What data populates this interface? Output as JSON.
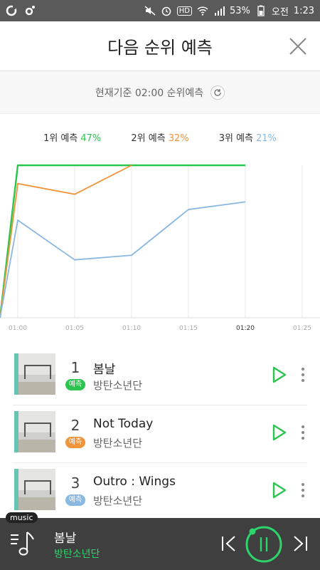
{
  "status": {
    "battery": "53%",
    "ampm": "오전",
    "time": "1:23",
    "hd": "HD"
  },
  "header": {
    "title": "다음 순위 예측"
  },
  "subheader": {
    "text": "현재기준 02:00 순위예측"
  },
  "legend": [
    {
      "label": "1위 예측",
      "pct": "47%",
      "color": "#2bc44e"
    },
    {
      "label": "2위 예측",
      "pct": "32%",
      "color": "#f0943a"
    },
    {
      "label": "3위 예측",
      "pct": "21%",
      "color": "#8ab8e0"
    }
  ],
  "chart_data": {
    "type": "line",
    "x": [
      "01:00",
      "01:05",
      "01:10",
      "01:15",
      "01:20",
      "01:25"
    ],
    "highlight_tick": "01:20",
    "series": [
      {
        "color": "#2bc44e",
        "values": [
          100,
          100,
          100,
          100,
          100
        ]
      },
      {
        "color": "#f0943a",
        "values": [
          88,
          81,
          100
        ]
      },
      {
        "color": "#8ab8e0",
        "values": [
          64,
          38,
          41,
          71,
          76
        ]
      }
    ],
    "ylim": [
      0,
      100
    ]
  },
  "songs": [
    {
      "rank": "1",
      "badge": "예측",
      "badge_color": "#2bc44e",
      "title": "봄날",
      "artist": "방탄소년단"
    },
    {
      "rank": "2",
      "badge": "예측",
      "badge_color": "#f0943a",
      "title": "Not Today",
      "artist": "방탄소년단"
    },
    {
      "rank": "3",
      "badge": "예측",
      "badge_color": "#8ab8e0",
      "title": "Outro : Wings",
      "artist": "방탄소년단"
    }
  ],
  "player": {
    "tag": "music",
    "title": "봄날",
    "artist": "방탄소년단",
    "accent": "#2dd36b"
  }
}
